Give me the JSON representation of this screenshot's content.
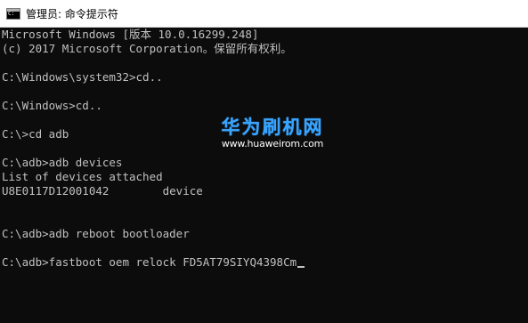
{
  "window": {
    "title": "管理员: 命令提示符",
    "icon": "cmd-icon"
  },
  "console": {
    "lines": [
      "Microsoft Windows [版本 10.0.16299.248]",
      "(c) 2017 Microsoft Corporation。保留所有权利。",
      "",
      "C:\\Windows\\system32>cd..",
      "",
      "C:\\Windows>cd..",
      "",
      "C:\\>cd adb",
      "",
      "C:\\adb>adb devices",
      "List of devices attached",
      "U8E0117D12001042        device",
      "",
      "",
      "C:\\adb>adb reboot bootloader",
      "",
      "C:\\adb>fastboot oem relock FD5AT79SIYQ4398Cm"
    ]
  },
  "watermark": {
    "brand": "华为刷机网",
    "url": "www.huaweirom.com"
  },
  "colors": {
    "console_bg": "#0c0c0c",
    "console_text": "#c0c0c0",
    "titlebar_bg": "#ffffff",
    "watermark_blue": "#39a4ff"
  }
}
